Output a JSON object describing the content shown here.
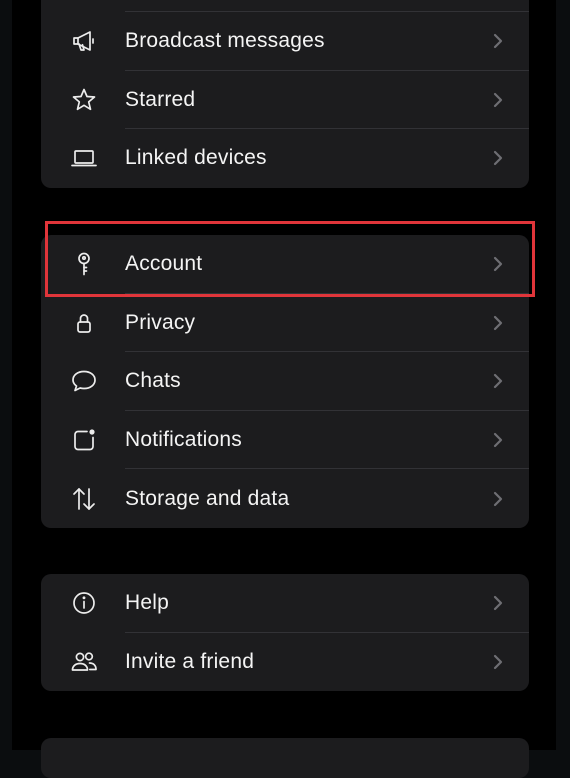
{
  "colors": {
    "background": "#000000",
    "card": "#1c1c1e",
    "divider": "#323236",
    "text": "#f4f4f4",
    "chevron": "#6e6e73",
    "highlight": "#e0353a"
  },
  "groups": [
    {
      "items": [
        {
          "label": "Broadcast messages",
          "icon": "megaphone-icon"
        },
        {
          "label": "Starred",
          "icon": "star-icon"
        },
        {
          "label": "Linked devices",
          "icon": "laptop-icon"
        }
      ]
    },
    {
      "items": [
        {
          "label": "Account",
          "icon": "key-icon",
          "highlighted": true
        },
        {
          "label": "Privacy",
          "icon": "lock-icon"
        },
        {
          "label": "Chats",
          "icon": "chat-bubble-icon"
        },
        {
          "label": "Notifications",
          "icon": "notification-badge-icon"
        },
        {
          "label": "Storage and data",
          "icon": "up-down-arrows-icon"
        }
      ]
    },
    {
      "items": [
        {
          "label": "Help",
          "icon": "info-icon"
        },
        {
          "label": "Invite a friend",
          "icon": "people-icon"
        }
      ]
    }
  ]
}
